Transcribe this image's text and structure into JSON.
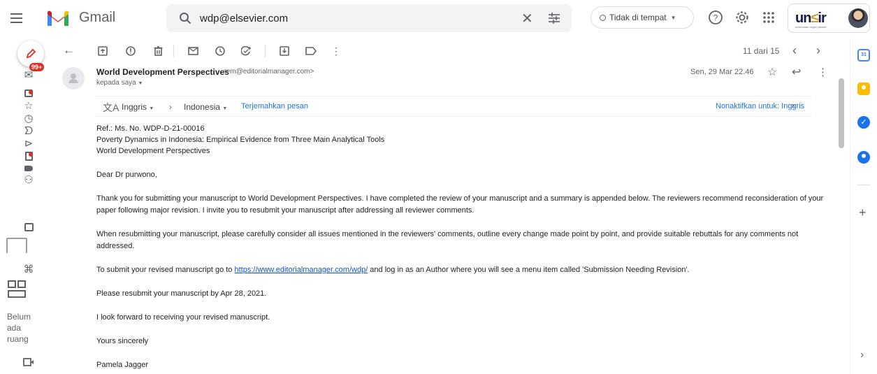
{
  "header": {
    "app_name": "Gmail",
    "search_value": "wdp@elsevier.com",
    "status_label": "Tidak di tempat",
    "org_logo_text": "un",
    "org_logo_text2": "ir",
    "org_logo_caption": "universitas negeri jakarta"
  },
  "sidebar": {
    "badge": "99+",
    "storage_text_1": "Belum",
    "storage_text_2": "ada",
    "storage_text_3": "ruang"
  },
  "toolbar": {
    "pager": "11 dari 15"
  },
  "email": {
    "sender_name": "World Development Perspectives",
    "sender_email": "<em@editorialmanager.com>",
    "to_line": "kepada saya",
    "date": "Sen, 29 Mar 22.46",
    "translate": {
      "source_lang": "Inggris",
      "target_lang": "Indonesia",
      "translate_link": "Terjemahkan pesan",
      "disable_link": "Nonaktifkan untuk: Inggris"
    },
    "body": {
      "ref": "Ref.:  Ms. No. WDP-D-21-00016",
      "title": "Poverty Dynamics in Indonesia: Empirical Evidence from Three Main Analytical Tools",
      "journal": "World Development Perspectives",
      "greeting": "Dear Dr purwono,",
      "para1": "Thank you for submitting your manuscript to World Development Perspectives.  I have completed the review of your manuscript and a summary is appended below. The reviewers recommend reconsideration of your paper following major revision. I invite you to resubmit your manuscript after addressing all reviewer comments.",
      "para2": "When resubmitting your manuscript, please carefully consider all issues mentioned in the reviewers' comments, outline every change made point by point, and provide suitable rebuttals for any comments not addressed.",
      "para3_before": "To submit your revised manuscript go to ",
      "para3_link": "https://www.editorialmanager.com/wdp/",
      "para3_after": " and log in as an Author where you will see a menu item called 'Submission Needing Revision'.",
      "para4": "Please resubmit your manuscript by Apr 28, 2021.",
      "para5": "I look forward to receiving your revised manuscript.",
      "closing": "Yours sincerely",
      "signature": "Pamela Jagger"
    }
  },
  "colors": {
    "accent_blue": "#1a73e8",
    "badge_red": "#d93025",
    "link_blue": "#1155cc"
  }
}
